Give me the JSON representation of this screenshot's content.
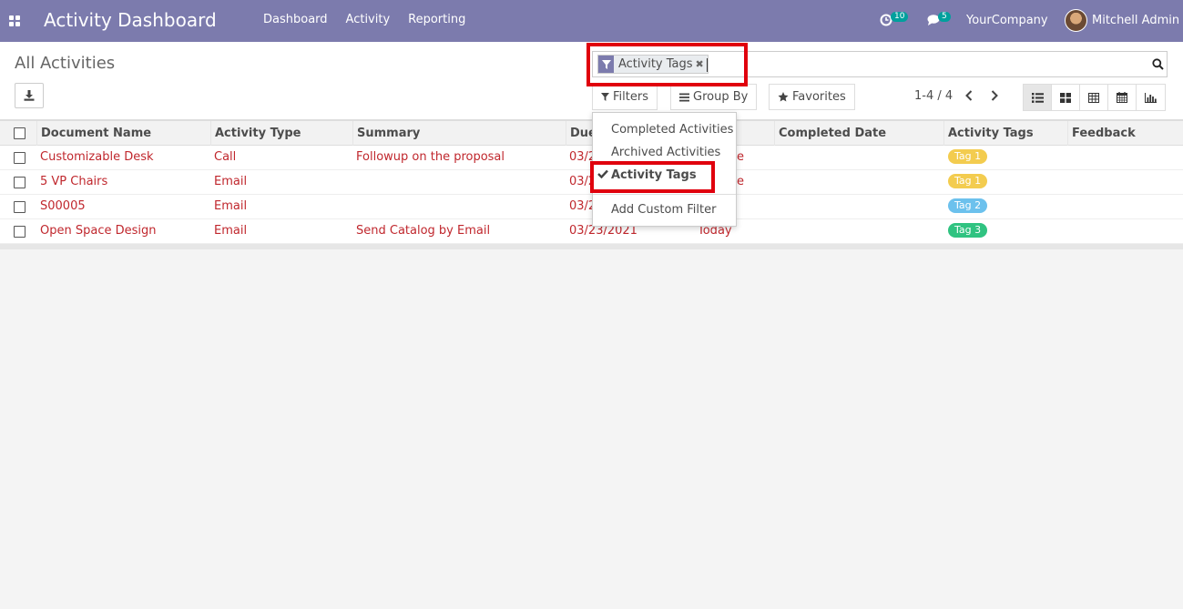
{
  "navbar": {
    "app_title": "Activity Dashboard",
    "menu": [
      "Dashboard",
      "Activity",
      "Reporting"
    ],
    "activity_count": "10",
    "message_count": "5",
    "company": "YourCompany",
    "user": "Mitchell Admin",
    "bg_color": "#7c7bad"
  },
  "control": {
    "breadcrumb": "All Activities",
    "facet_label": "Activity Tags",
    "filters_label": "Filters",
    "groupby_label": "Group By",
    "favorites_label": "Favorites",
    "pager": "1-4 / 4"
  },
  "filters_dropdown": {
    "items": [
      "Completed Activities",
      "Archived Activities",
      "Activity Tags"
    ],
    "checked_item": "Activity Tags",
    "custom": "Add Custom Filter"
  },
  "table": {
    "headers": [
      "Document Name",
      "Activity Type",
      "Summary",
      "Due",
      "",
      "Completed Date",
      "Activity Tags",
      "Feedback"
    ],
    "rows": [
      {
        "doc": "Customizable Desk",
        "type": "Call",
        "summary": "Followup on the proposal",
        "due": "03/2",
        "status": "e",
        "tag": "Tag 1",
        "tag_color": "#f3cc4f"
      },
      {
        "doc": "5 VP Chairs",
        "type": "Email",
        "summary": "",
        "due": "03/2",
        "status": "e",
        "tag": "Tag 1",
        "tag_color": "#f3cc4f"
      },
      {
        "doc": "S00005",
        "type": "Email",
        "summary": "",
        "due": "03/2",
        "status": "",
        "tag": "Tag 2",
        "tag_color": "#6cc1ed"
      },
      {
        "doc": "Open Space Design",
        "type": "Email",
        "summary": "Send Catalog by Email",
        "due": "03/23/2021",
        "status": "Today",
        "tag": "Tag 3",
        "tag_color": "#30c381"
      }
    ]
  }
}
